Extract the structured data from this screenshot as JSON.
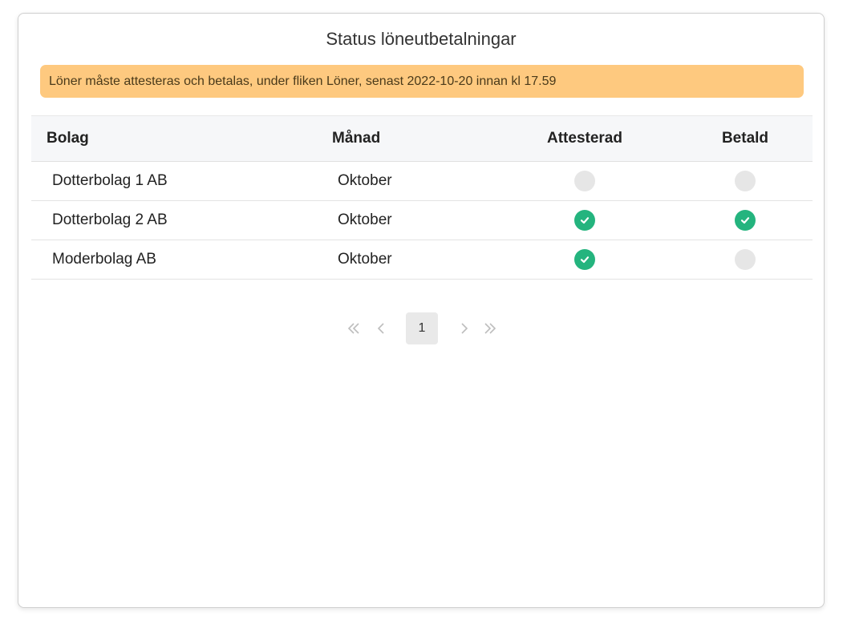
{
  "title": "Status löneutbetalningar",
  "alert": "Löner måste attesteras och betalas, under fliken Löner, senast 2022-10-20 innan kl 17.59",
  "table": {
    "headers": [
      "Bolag",
      "Månad",
      "Attesterad",
      "Betald"
    ],
    "rows": [
      {
        "bolag": "Dotterbolag 1 AB",
        "manad": "Oktober",
        "attesterad": false,
        "betald": false
      },
      {
        "bolag": "Dotterbolag 2 AB",
        "manad": "Oktober",
        "attesterad": true,
        "betald": true
      },
      {
        "bolag": "Moderbolag AB",
        "manad": "Oktober",
        "attesterad": true,
        "betald": false
      }
    ]
  },
  "pagination": {
    "current_page": "1",
    "first_icon": "double-chevron-left-icon",
    "prev_icon": "chevron-left-icon",
    "next_icon": "chevron-right-icon",
    "last_icon": "double-chevron-right-icon"
  },
  "colors": {
    "alert_bg": "#fec97f",
    "status_done": "#24b47e",
    "status_pending": "#e6e6e6"
  }
}
